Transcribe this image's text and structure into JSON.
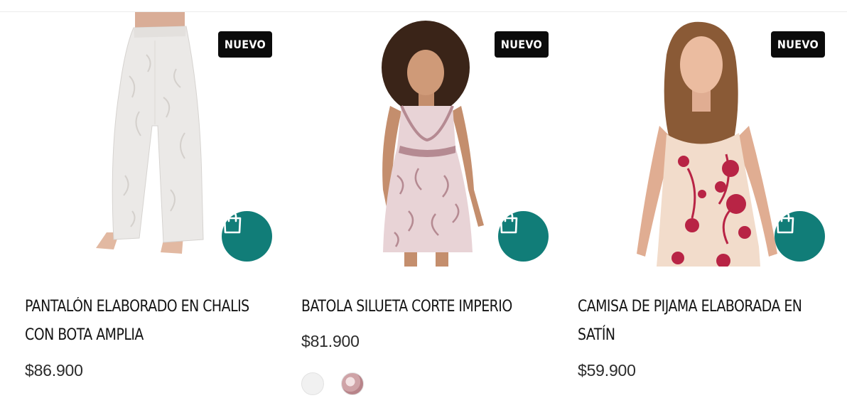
{
  "products": [
    {
      "badge": "NUEVO",
      "title_line1": "PANTALÓN ELABORADO EN CHALIS",
      "title_line2": "CON BOTA AMPLIA",
      "price": "$86.900",
      "photo_icon": "product-photo-pants",
      "colors": {
        "garment": "#ebe9e7",
        "pattern": "#d8d5d2"
      }
    },
    {
      "badge": "NUEVO",
      "title_line1": "BATOLA SILUETA CORTE IMPERIO",
      "title_line2": "",
      "price": "$81.900",
      "photo_icon": "product-photo-nightgown",
      "swatches": [
        {
          "name": "white-swatch",
          "color": "#f1f1f1"
        },
        {
          "name": "pink-print-swatch",
          "color": "#cfa3a7"
        }
      ],
      "colors": {
        "garment": "#e8d3d6",
        "pattern": "#b58a92"
      }
    },
    {
      "badge": "NUEVO",
      "title_line1": "CAMISA DE PIJAMA ELABORADA EN",
      "title_line2": "SATÍN",
      "price": "$59.900",
      "photo_icon": "product-photo-satin-camisole",
      "colors": {
        "garment": "#f2dccb",
        "pattern": "#b82445"
      }
    }
  ],
  "theme": {
    "accent": "#117d78",
    "badge_bg": "#0b0b0b"
  },
  "cart_icon": "shopping-bag-icon"
}
